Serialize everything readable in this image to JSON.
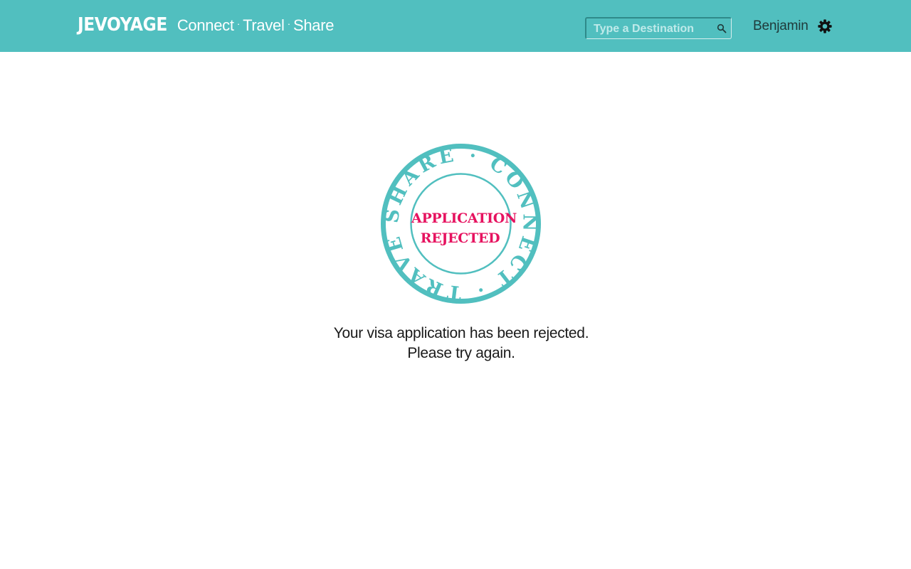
{
  "header": {
    "brand": "JEVOYAGE",
    "tagline": [
      "Connect",
      "Travel",
      "Share"
    ],
    "separator": "·",
    "search_placeholder": "Type a Destination",
    "user_name": "Benjamin"
  },
  "stamp": {
    "ring_words": [
      "SHARE",
      "CONNECT",
      "TRAVEL"
    ],
    "label_line1": "APPLICATION",
    "label_line2": "REJECTED"
  },
  "message": {
    "line1": "Your visa application has been rejected.",
    "line2": "Please try again."
  },
  "icons": {
    "search": "search-icon",
    "settings": "gear-icon"
  },
  "colors": {
    "header_bg": "#51bfbf",
    "accent": "#51bfbf",
    "rejected": "#e6125f",
    "user_text": "#1f3a3a"
  }
}
